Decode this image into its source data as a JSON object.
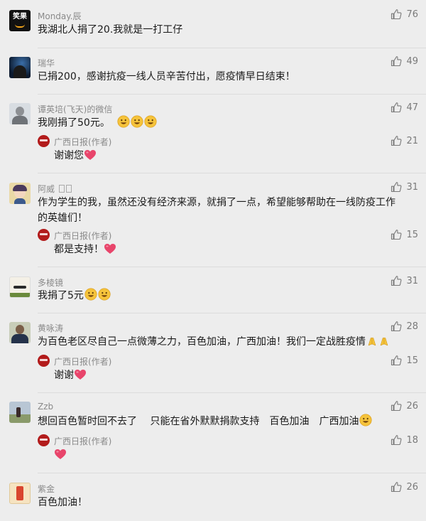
{
  "comments": [
    {
      "name": "Monday.辰",
      "text": "我湖北人捐了20.我就是一打工仔",
      "likes": "76",
      "avatar_text": "笑果"
    },
    {
      "name": "瑞华",
      "text": "已捐200，感谢抗疫一线人员辛苦付出，愿疫情早日结束！",
      "likes": "49"
    },
    {
      "name": "谭英培(飞天)的微信",
      "text": "我刚捐了50元。",
      "likes": "47",
      "reply": {
        "name": "广西日报(作者)",
        "text": "谢谢您",
        "likes": "21"
      }
    },
    {
      "name": "阿威",
      "text_line1": "作为学生的我，虽然还没有经济来源，就捐了一点，希望能够帮助在一线防疫工作",
      "text_line2": "的英雄们！",
      "likes": "31",
      "reply": {
        "name": "广西日报(作者)",
        "text": "都是支持！",
        "likes": "15"
      }
    },
    {
      "name": "多棱镜",
      "text": "我捐了5元",
      "likes": "31"
    },
    {
      "name": "黄咏涛",
      "text": "为百色老区尽自己一点微薄之力，百色加油，广西加油！我们一定战胜疫情",
      "likes": "28",
      "reply": {
        "name": "广西日报(作者)",
        "text": "谢谢",
        "likes": "15"
      }
    },
    {
      "name": "Zzb",
      "text": "想回百色暂时回不去了　 只能在省外默默捐款支持　百色加油　广西加油",
      "likes": "26",
      "reply": {
        "name": "广西日报(作者)",
        "text": "",
        "likes": "18"
      }
    },
    {
      "name": "紫金",
      "text": "百色加油！",
      "likes": "26"
    }
  ],
  "colors": {
    "background": "#ededed",
    "name": "#8a8a8a",
    "text": "#1a1a1a",
    "heart": "#e8456b",
    "emoji": "#f5c33b",
    "reply_avatar": "#b21b1b"
  },
  "icons": {
    "like": "thumbs-up-icon",
    "heart": "heart-emoji",
    "smile": "smile-emoji",
    "pray": "pray-emoji"
  }
}
